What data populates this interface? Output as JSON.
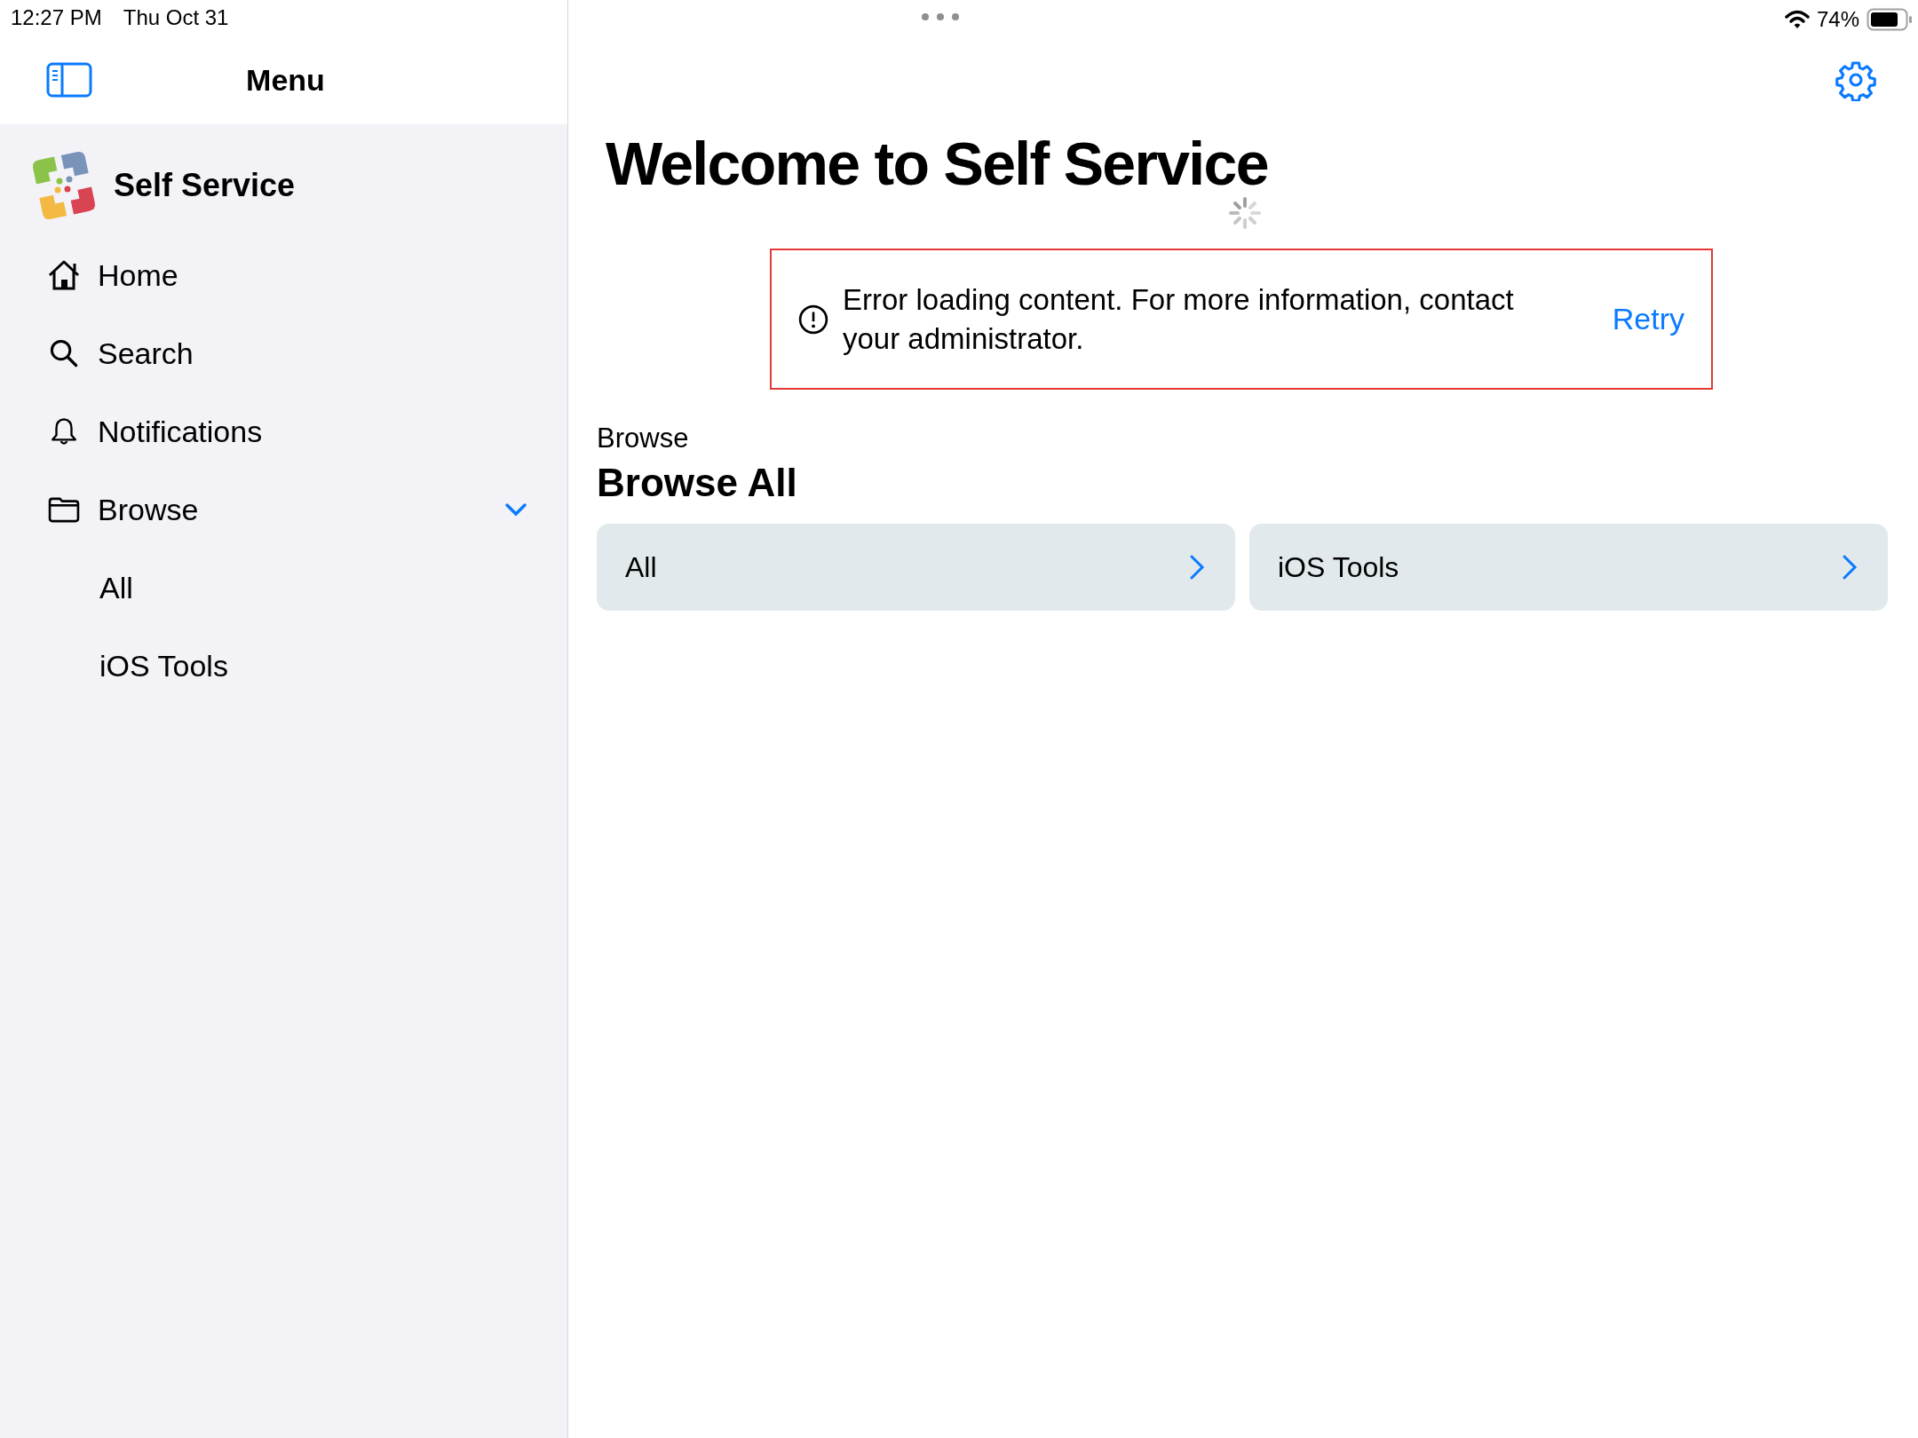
{
  "status_bar": {
    "time": "12:27 PM",
    "date": "Thu Oct 31",
    "battery": "74%"
  },
  "sidebar": {
    "title": "Menu",
    "app_name": "Self Service",
    "items": [
      {
        "label": "Home",
        "kind": "home"
      },
      {
        "label": "Search",
        "kind": "search"
      },
      {
        "label": "Notifications",
        "kind": "bell"
      },
      {
        "label": "Browse",
        "kind": "folder",
        "expanded": true,
        "children": [
          {
            "label": "All"
          },
          {
            "label": "iOS Tools"
          }
        ]
      }
    ]
  },
  "main": {
    "title": "Welcome to Self Service",
    "error": {
      "message": "Error loading content. For more information, contact your administrator.",
      "action": "Retry"
    },
    "section_label": "Browse",
    "section_title": "Browse All",
    "cards": [
      {
        "label": "All"
      },
      {
        "label": "iOS Tools"
      }
    ]
  }
}
